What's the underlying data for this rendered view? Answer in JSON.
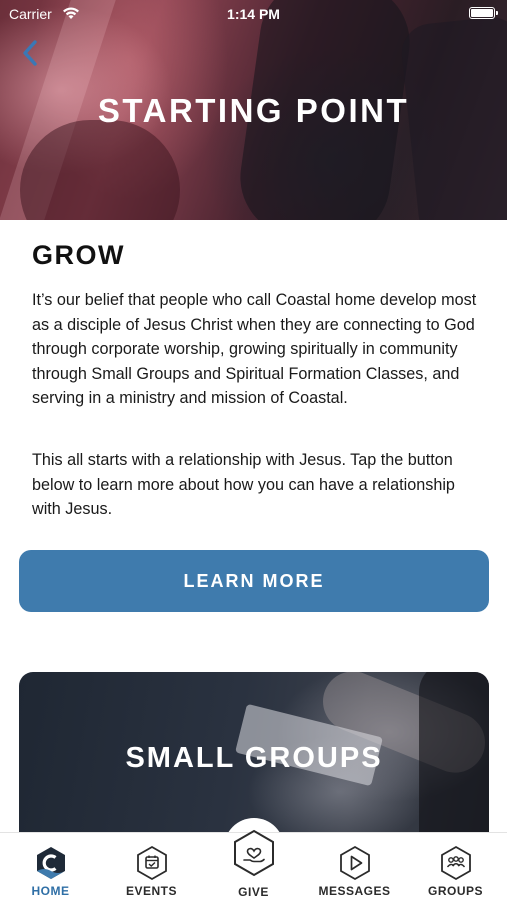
{
  "status_bar": {
    "carrier": "Carrier",
    "time": "1:14 PM"
  },
  "hero": {
    "title": "STARTING POINT"
  },
  "section": {
    "title": "GROW",
    "paragraph_1": "It’s our belief that people who call Coastal home develop most as a disciple of Jesus Christ when they are connecting to God through corporate worship, growing spiritually in community through Small Groups and Spiritual Formation Classes, and serving in a ministry and mission of Coastal.",
    "paragraph_2": "This all starts with a relationship with Jesus. Tap the button below to learn more about how you can have a relationship with Jesus."
  },
  "learn_more": {
    "label": "LEARN MORE"
  },
  "card": {
    "title": "SMALL GROUPS"
  },
  "tabs": [
    {
      "label": "HOME",
      "icon": "coastal-logo-icon"
    },
    {
      "label": "EVENTS",
      "icon": "calendar-icon"
    },
    {
      "label": "GIVE",
      "icon": "give-heart-icon"
    },
    {
      "label": "MESSAGES",
      "icon": "play-icon"
    },
    {
      "label": "GROUPS",
      "icon": "people-icon"
    }
  ],
  "colors": {
    "accent": "#3f7bad",
    "active_tab": "#2f6fa6"
  }
}
